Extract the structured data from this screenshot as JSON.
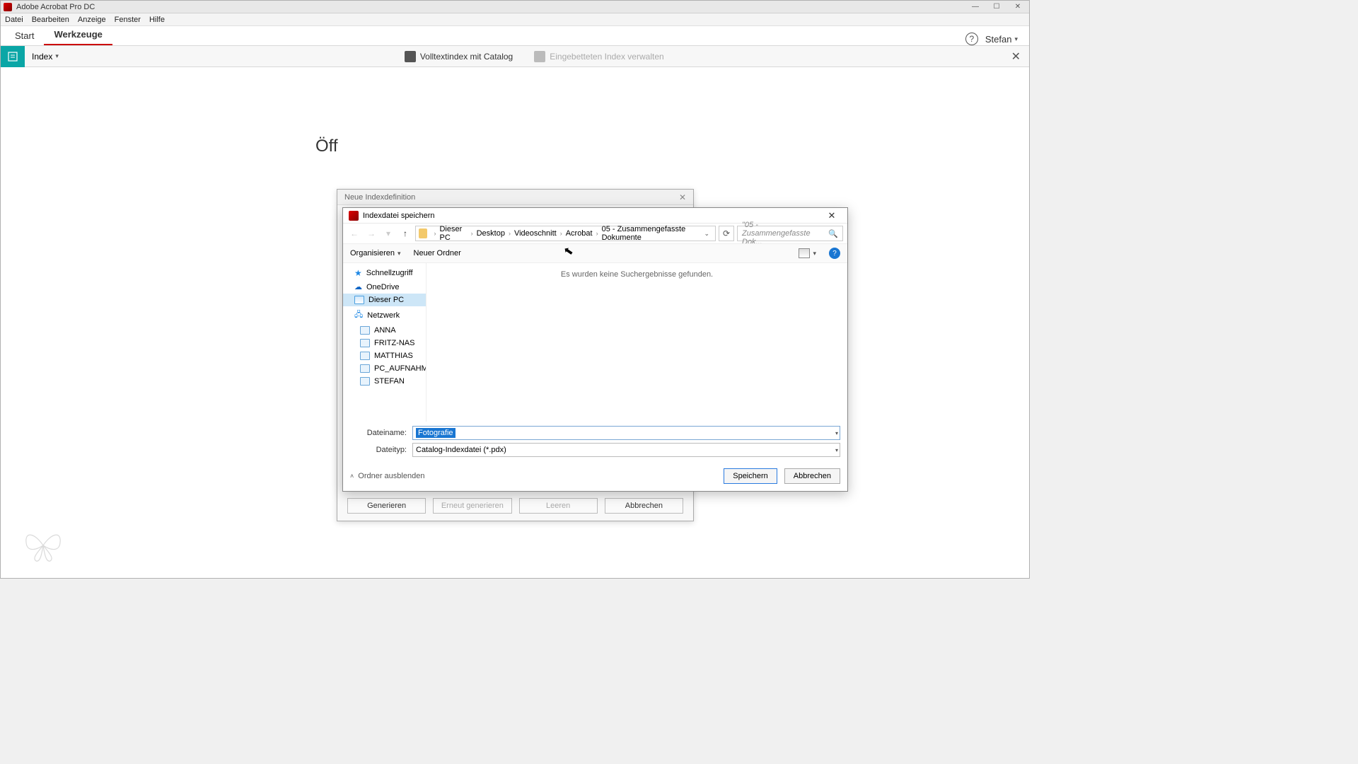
{
  "titlebar": {
    "title": "Adobe Acrobat Pro DC"
  },
  "menubar": [
    "Datei",
    "Bearbeiten",
    "Anzeige",
    "Fenster",
    "Hilfe"
  ],
  "tabs": {
    "start": "Start",
    "tools": "Werkzeuge"
  },
  "user": "Stefan",
  "toolbar": {
    "index": "Index",
    "fulltext": "Volltextindex mit Catalog",
    "embedded": "Eingebetteten Index verwalten"
  },
  "bg_text": "Öff",
  "bg_dialog": {
    "title": "Neue Indexdefinition",
    "generate": "Generieren",
    "regenerate": "Erneut generieren",
    "clear": "Leeren",
    "cancel": "Abbrechen"
  },
  "save_dialog": {
    "title": "Indexdatei speichern",
    "breadcrumb": [
      "Dieser PC",
      "Desktop",
      "Videoschnitt",
      "Acrobat",
      "05 - Zusammengefasste Dokumente"
    ],
    "search_placeholder": "\"05 - Zusammengefasste Dok...",
    "organize": "Organisieren",
    "new_folder": "Neuer Ordner",
    "tree": {
      "quick": "Schnellzugriff",
      "onedrive": "OneDrive",
      "thispc": "Dieser PC",
      "network": "Netzwerk",
      "computers": [
        "ANNA",
        "FRITZ-NAS",
        "MATTHIAS",
        "PC_AUFNAHME",
        "STEFAN"
      ]
    },
    "empty_msg": "Es wurden keine Suchergebnisse gefunden.",
    "filename_label": "Dateiname:",
    "filename_value": "Fotografie",
    "filetype_label": "Dateityp:",
    "filetype_value": "Catalog-Indexdatei (*.pdx)",
    "hide_folders": "Ordner ausblenden",
    "save": "Speichern",
    "cancel": "Abbrechen"
  }
}
